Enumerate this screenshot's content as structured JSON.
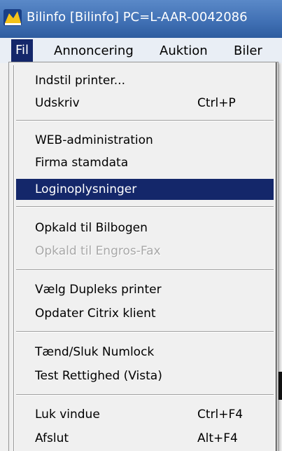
{
  "window": {
    "title": "Bilinfo [Bilinfo]  PC=L-AAR-0042086",
    "icon": "bilinfo-logo-icon"
  },
  "menubar": {
    "items": [
      {
        "label": "Fil",
        "active": true
      },
      {
        "label": "Annoncering",
        "active": false
      },
      {
        "label": "Auktion",
        "active": false
      },
      {
        "label": "Biler",
        "active": false
      }
    ]
  },
  "dropdown": {
    "items": [
      {
        "label": "Indstil printer...",
        "shortcut": ""
      },
      {
        "label": "Udskriv",
        "shortcut": "Ctrl+P"
      },
      {
        "label": "WEB-administration",
        "shortcut": ""
      },
      {
        "label": "Firma stamdata",
        "shortcut": ""
      },
      {
        "label": "Loginoplysninger",
        "shortcut": "",
        "selected": true
      },
      {
        "label": "Opkald til Bilbogen",
        "shortcut": ""
      },
      {
        "label": "Opkald til Engros-Fax",
        "shortcut": "",
        "disabled": true
      },
      {
        "label": "Vælg Dupleks printer",
        "shortcut": ""
      },
      {
        "label": "Opdater Citrix klient",
        "shortcut": ""
      },
      {
        "label": "Tænd/Sluk Numlock",
        "shortcut": ""
      },
      {
        "label": "Test Rettighed (Vista)",
        "shortcut": ""
      },
      {
        "label": "Luk vindue",
        "shortcut": "Ctrl+F4"
      },
      {
        "label": "Afslut",
        "shortcut": "Alt+F4"
      }
    ]
  },
  "colors": {
    "selection": "#14276a",
    "titlebar": "#3f6fb3",
    "menu_background": "#f0f0f0",
    "disabled_text": "#a8a8a8"
  }
}
